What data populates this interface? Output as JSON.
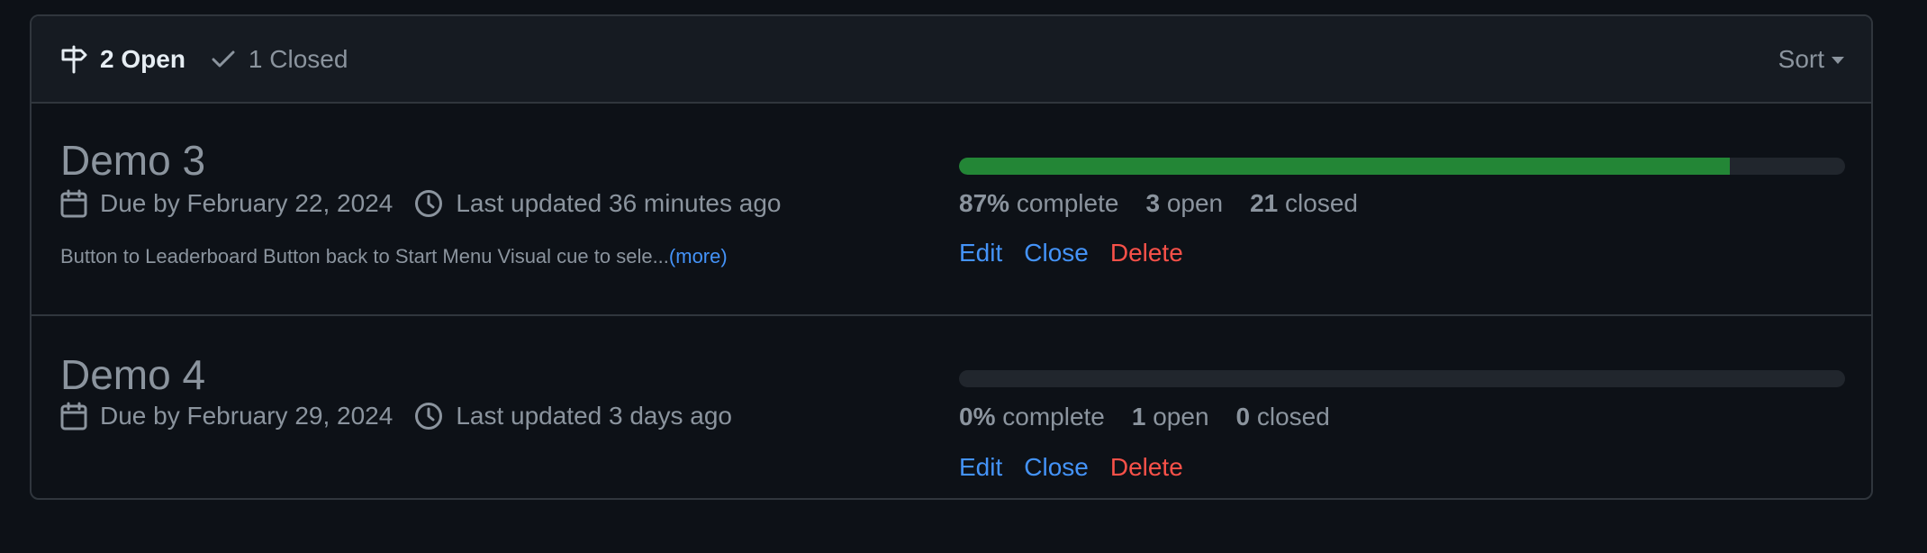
{
  "header": {
    "open_count": "2",
    "open_label": "Open",
    "closed_count": "1",
    "closed_label": "Closed",
    "sort_label": "Sort"
  },
  "milestones": [
    {
      "title": "Demo 3",
      "due": "Due by February 22, 2024",
      "updated": "Last updated 36 minutes ago",
      "description": "Button to Leaderboard Button back to Start Menu Visual cue to sele...",
      "more_label": "(more)",
      "progress_percent": 87,
      "percent_text": "87%",
      "complete_label": "complete",
      "open_count": "3",
      "open_label": "open",
      "closed_count": "21",
      "closed_label": "closed",
      "actions": {
        "edit": "Edit",
        "close": "Close",
        "delete": "Delete"
      }
    },
    {
      "title": "Demo 4",
      "due": "Due by February 29, 2024",
      "updated": "Last updated 3 days ago",
      "progress_percent": 0,
      "percent_text": "0%",
      "complete_label": "complete",
      "open_count": "1",
      "open_label": "open",
      "closed_count": "0",
      "closed_label": "closed",
      "actions": {
        "edit": "Edit",
        "close": "Close",
        "delete": "Delete"
      }
    }
  ],
  "colors": {
    "background": "#0d1117",
    "header_bg": "#161b22",
    "border": "#30363d",
    "progress_fill": "#238636",
    "progress_track": "#21262d",
    "link": "#4493f8",
    "danger": "#f85149",
    "muted_text": "#8b949e",
    "bright_text": "#e6edf3"
  },
  "icons": {
    "open": "milestone-icon",
    "closed": "check-icon",
    "due": "calendar-icon",
    "updated": "clock-icon",
    "sort": "caret-down-icon"
  }
}
